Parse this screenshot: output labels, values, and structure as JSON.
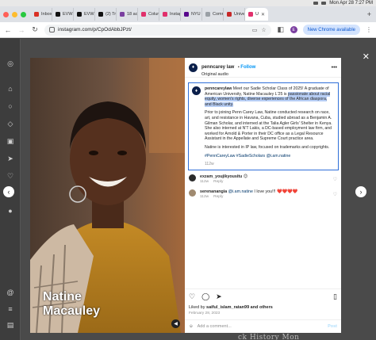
{
  "menubar": {
    "datetime": "Mon Apr 28  7:27 PM"
  },
  "tabs": [
    {
      "label": "Inbox",
      "color": "#d93025"
    },
    {
      "label": "EVW",
      "color": "#111111"
    },
    {
      "label": "EVW",
      "color": "#111111"
    },
    {
      "label": "(2) Tr",
      "color": "#111111"
    },
    {
      "label": "18 ac",
      "color": "#7b3fa0"
    },
    {
      "label": "Colun",
      "color": "#e1306c"
    },
    {
      "label": "Instag",
      "color": "#e1306c"
    },
    {
      "label": "NYU",
      "color": "#57068c"
    },
    {
      "label": "Comr",
      "color": "#9aa0a6"
    },
    {
      "label": "Unive",
      "color": "#c62828"
    },
    {
      "label": "U",
      "color": "#e1306c",
      "active": true
    }
  ],
  "address": {
    "url": "instagram.com/p/CpOdAbbJPzt/",
    "profile_initial": "E",
    "new_chrome": "New Chrome available"
  },
  "post": {
    "username": "penncarey law",
    "follow": "Follow",
    "audio": "Original audio",
    "photo_caption_line1": "Natine",
    "photo_caption_line2": "Macauley",
    "caption": {
      "user": "penncareylaw",
      "p1a": " Meet our Sadie Scholar Class of 2025! A graduate of American University, Natine Macauley L'25 is ",
      "p1b": "passionate about racial equity, women's rights, diverse experiences of the African diaspora, and Black unity.",
      "p2": "Prior to joining Penn Carey Law, Natine conducted research on race, art, and resistance in Havana, Cuba, studied abroad as a Benjamin A. Gilman Scholar, and interned at the Talia Agler Girls' Shelter in Kenya. She also interned at N'T Lakis, a DC-based employment law firm, and worked for Arnold & Porter in their DC office as a Legal Resource Assistant in the Appellate and Supreme Court practice area.",
      "p3": "Natine is interested in IP law, focused on trademarks and copyrights.",
      "tags": "#PennCareyLaw #SadieScholars @i.am.natine",
      "ago": "112w"
    },
    "comments": [
      {
        "user": "exzam_youjikyousitu",
        "text": " 😊",
        "ago": "112w",
        "reply": "Reply",
        "avatar": "#2b2b2b"
      },
      {
        "user": "serenanangia",
        "mention": " @i.am.natine",
        "text": " I love you!!! ",
        "hearts": "❤️❤️❤️❤️",
        "ago": "112w",
        "reply": "Reply",
        "avatar": "#a08a70"
      }
    ],
    "liked_prefix": "Liked by ",
    "liked_user": "saiful_islam_ratan99",
    "liked_suffix": " and others",
    "date": "February 28, 2023",
    "add_comment": "Add a comment...",
    "post_btn": "Post"
  },
  "background_text": "ck History Mon"
}
